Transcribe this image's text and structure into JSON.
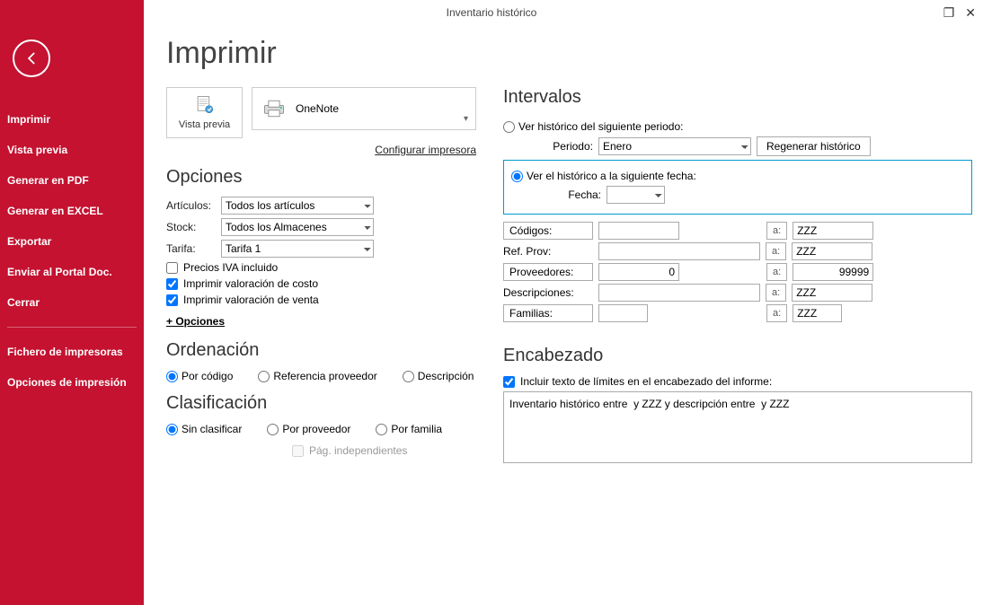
{
  "window": {
    "title": "Inventario histórico"
  },
  "sidebar": {
    "items": [
      "Imprimir",
      "Vista previa",
      "Generar en PDF",
      "Generar en EXCEL",
      "Exportar",
      "Enviar al Portal Doc.",
      "Cerrar"
    ],
    "footer": [
      "Fichero de impresoras",
      "Opciones de impresión"
    ]
  },
  "page": {
    "title": "Imprimir"
  },
  "print": {
    "preview_label": "Vista previa",
    "printer_name": "OneNote",
    "configure_label": "Configurar impresora"
  },
  "opciones": {
    "heading": "Opciones",
    "articulos_label": "Artículos:",
    "articulos_value": "Todos los artículos",
    "stock_label": "Stock:",
    "stock_value": "Todos los Almacenes",
    "tarifa_label": "Tarifa:",
    "tarifa_value": "Tarifa 1",
    "chk_iva": "Precios IVA incluido",
    "chk_costo": "Imprimir valoración de costo",
    "chk_venta": "Imprimir valoración de venta",
    "more": "+ Opciones"
  },
  "ordenacion": {
    "heading": "Ordenación",
    "codigo": "Por código",
    "ref": "Referencia proveedor",
    "desc": "Descripción"
  },
  "clasificacion": {
    "heading": "Clasificación",
    "sin": "Sin clasificar",
    "prov": "Por proveedor",
    "fam": "Por familia",
    "pag": "Pág. independientes"
  },
  "intervalos": {
    "heading": "Intervalos",
    "opt_periodo": "Ver histórico del siguiente periodo:",
    "periodo_label": "Periodo:",
    "periodo_value": "Enero",
    "regenerar": "Regenerar histórico",
    "opt_fecha": "Ver el histórico a la siguiente fecha:",
    "fecha_label": "Fecha:",
    "fecha_value": "",
    "codigos": "Códigos:",
    "codigos_from": "",
    "codigos_to": "ZZZ",
    "refprov": "Ref. Prov:",
    "refprov_from": "",
    "refprov_to": "ZZZ",
    "proveedores": "Proveedores:",
    "prov_from": "0",
    "prov_to": "99999",
    "descripciones": "Descripciones:",
    "desc_from": "",
    "desc_to": "ZZZ",
    "familias": "Familias:",
    "fam_from": "",
    "fam_to": "ZZZ",
    "a": "a:"
  },
  "encabezado": {
    "heading": "Encabezado",
    "chk": "Incluir texto de límites en el encabezado del informe:",
    "text": "Inventario histórico entre  y ZZZ y descripción entre  y ZZZ"
  }
}
